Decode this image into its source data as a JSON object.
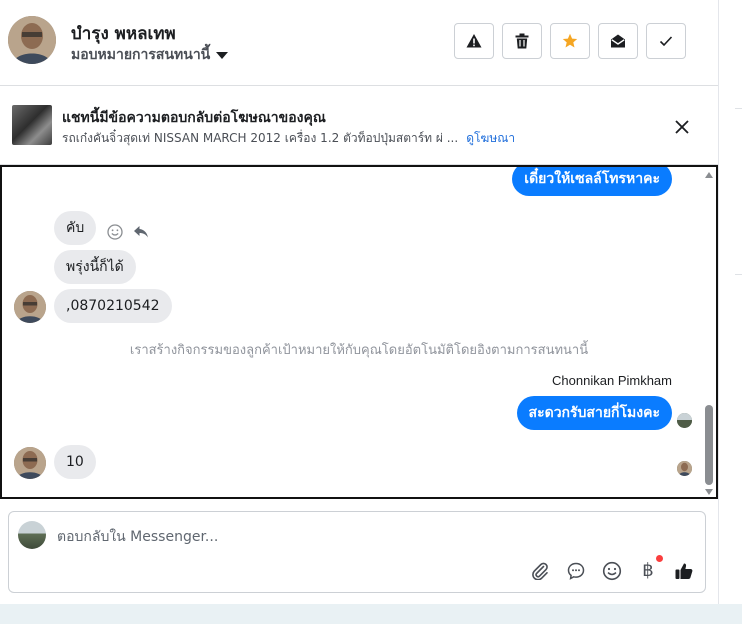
{
  "header": {
    "contact_name": "บำรุง พหลเทพ",
    "assign_label": "มอบหมายการสนทนานี้",
    "buttons": [
      {
        "name": "spam",
        "icon": "warning-icon"
      },
      {
        "name": "delete",
        "icon": "trash-icon"
      },
      {
        "name": "follow-up",
        "icon": "star-icon",
        "color": "#f5a623"
      },
      {
        "name": "mark-unread",
        "icon": "envelope-open-icon"
      },
      {
        "name": "mark-done",
        "icon": "check-icon"
      }
    ]
  },
  "ad": {
    "title": "แชทนี้มีข้อความตอบกลับต่อโฆษณาของคุณ",
    "subtitle": "รถเก๋งคันจิ๋วสุดเท่ NISSAN MARCH 2012 เครื่อง 1.2 ตัวท็อปปุ่มสตาร์ท ผ่ ...",
    "link": "ดูโฆษณา"
  },
  "chat": {
    "messages": [
      {
        "side": "out",
        "text": "เดี๋ยวให้เซลล์โทรหาคะ"
      },
      {
        "side": "in",
        "text": "คับ"
      },
      {
        "side": "in",
        "text": "พรุ่งนี้ก็ได้"
      },
      {
        "side": "in",
        "text": ",0870210542"
      },
      {
        "side": "out",
        "text": "สะดวกรับสายกี่โมงคะ"
      },
      {
        "side": "in",
        "text": "10"
      }
    ],
    "system_note": "เราสร้างกิจกรรมของลูกค้าเป้าหมายให้กับคุณโดยอัตโนมัติโดยอิงตามการสนทนานี้",
    "sender_name": "Chonnikan Pimkham"
  },
  "composer": {
    "placeholder": "ตอบกลับใน Messenger...",
    "baht_symbol": "฿",
    "tools": [
      "paperclip-icon",
      "saved-reply-icon",
      "emoji-icon",
      "payment-icon",
      "thumbs-up-icon"
    ]
  },
  "colors": {
    "accent": "#0a7cff",
    "incoming_bubble": "#e9eaed",
    "link": "#216fdb"
  }
}
